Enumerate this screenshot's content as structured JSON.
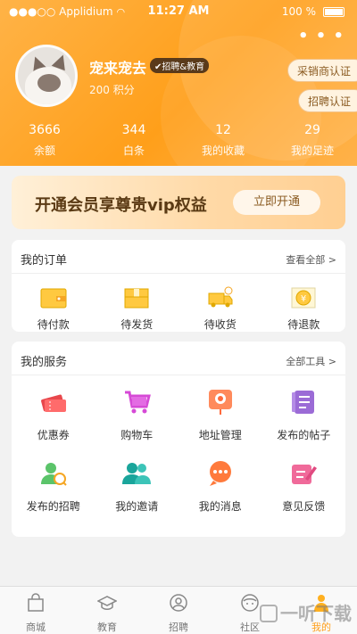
{
  "status_bar": {
    "carrier": "●●●○○ Applidium",
    "time": "11:27 AM",
    "battery": "100 %"
  },
  "header": {
    "more_icon": "more-dots-icon"
  },
  "profile": {
    "name": "宠来宠去",
    "tag": "✔招聘&教育",
    "points": "200 积分",
    "cert_buttons": [
      "采销商认证",
      "招聘认证"
    ]
  },
  "stats": [
    {
      "value": "3666",
      "label": "余额"
    },
    {
      "value": "344",
      "label": "白条"
    },
    {
      "value": "12",
      "label": "我的收藏"
    },
    {
      "value": "29",
      "label": "我的足迹"
    }
  ],
  "vip": {
    "text": "开通会员享尊贵vip权益",
    "button": "立即开通"
  },
  "orders": {
    "title": "我的订单",
    "more": "查看全部 >",
    "items": [
      {
        "label": "待付款",
        "icon": "wallet-icon"
      },
      {
        "label": "待发货",
        "icon": "package-icon"
      },
      {
        "label": "待收货",
        "icon": "truck-icon"
      },
      {
        "label": "待退款",
        "icon": "refund-icon"
      }
    ]
  },
  "services": {
    "title": "我的服务",
    "more": "全部工具 >",
    "items": [
      {
        "label": "优惠券",
        "icon": "coupon-icon"
      },
      {
        "label": "购物车",
        "icon": "cart-icon"
      },
      {
        "label": "地址管理",
        "icon": "location-icon"
      },
      {
        "label": "发布的帖子",
        "icon": "posts-icon"
      },
      {
        "label": "发布的招聘",
        "icon": "recruit-icon"
      },
      {
        "label": "我的邀请",
        "icon": "invite-icon"
      },
      {
        "label": "我的消息",
        "icon": "message-icon"
      },
      {
        "label": "意见反馈",
        "icon": "feedback-icon"
      }
    ]
  },
  "tabbar": [
    {
      "label": "商城",
      "icon": "shop-icon"
    },
    {
      "label": "教育",
      "icon": "education-icon"
    },
    {
      "label": "招聘",
      "icon": "recruit-tab-icon"
    },
    {
      "label": "社区",
      "icon": "community-icon"
    },
    {
      "label": "我的",
      "icon": "profile-icon",
      "active": true
    }
  ],
  "colors": {
    "accent": "#ff9f1a",
    "header_start": "#ffb347"
  },
  "watermark": "一听下载"
}
